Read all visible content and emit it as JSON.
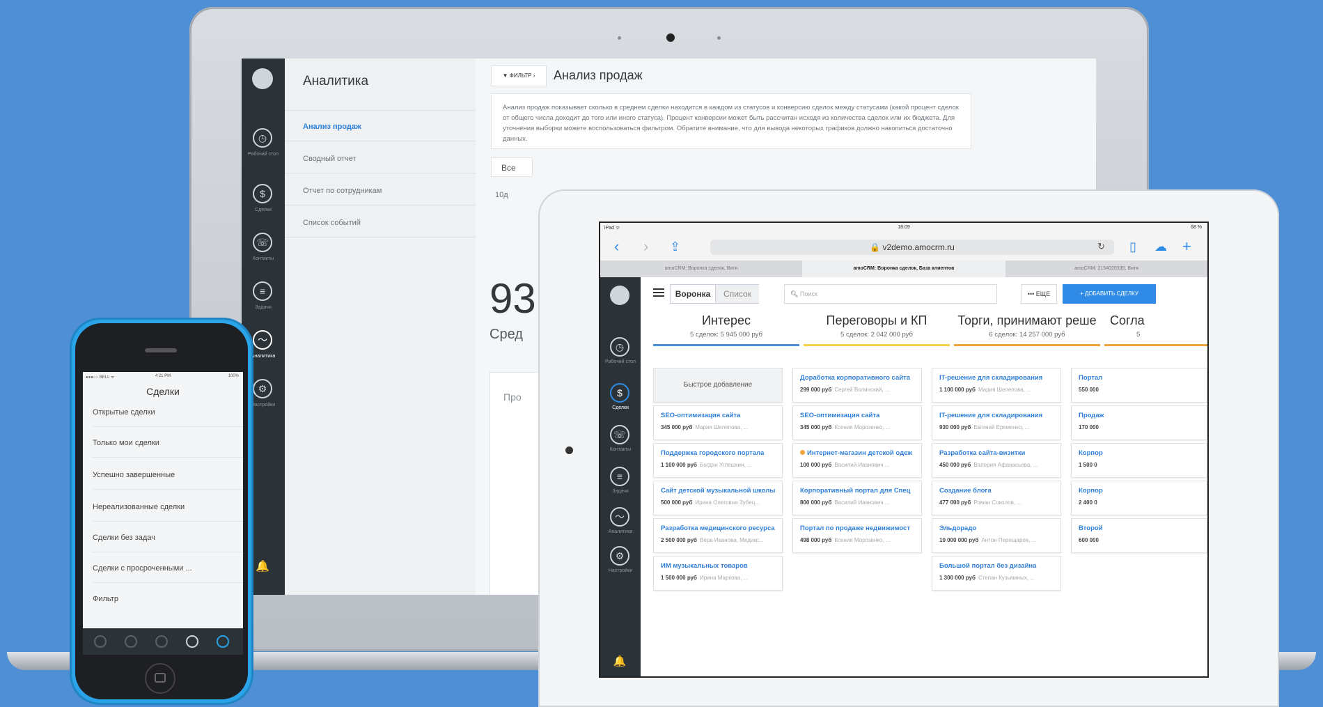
{
  "colors": {
    "background": "#4f8fd6",
    "accent": "#2f8be6",
    "sidebar": "#2c3338"
  },
  "laptop": {
    "nav_title": "Аналитика",
    "nav_items": [
      "Анализ продаж",
      "Сводный отчет",
      "Отчет по сотрудникам",
      "Список событий"
    ],
    "rail_labels": [
      "Рабочий стол",
      "Сделки",
      "Контакты",
      "Задачи",
      "Аналитика",
      "Настройки"
    ],
    "filter_label": "ФИЛЬТР",
    "main_title": "Анализ продаж",
    "description": "Анализ продаж показывает сколько в среднем сделки находится в каждом из статусов и конверсию сделок между статусами (какой процент сделок от общего числа доходит до того или иного статуса). Процент конверсии может быть рассчитан исходя из количества сделок или их бюджета. Для уточнения выборки можете воспользоваться фильтром. Обратите внимание, что для вывода некоторых графиков должно накопиться достаточно данных.",
    "all_label": "Все",
    "period_label": "10д",
    "big_number": "93",
    "subtitle": "Сред",
    "pro_label": "Про"
  },
  "phone": {
    "status_left": "●●●○○ BELL ᯤ",
    "status_time": "4:21 PM",
    "status_right": "100%",
    "title": "Сделки",
    "items": [
      "Открытые сделки",
      "Только мои сделки",
      "Успешно завершенные",
      "Нереализованные сделки",
      "Сделки без задач",
      "Сделки с просроченными ...",
      "Фильтр"
    ]
  },
  "ipad": {
    "status_left": "iPad ᯤ",
    "status_time": "18:09",
    "status_right": "68 %",
    "url": "v2demo.amocrm.ru",
    "tabs": [
      "amoCRM: Воронка сделок, Витя",
      "amoCRM: Воронка сделок, База клиентов",
      "amoCRM: 2154020335, Витя"
    ],
    "view_funnel": "Воронка",
    "view_list": "Список",
    "search_placeholder": "Поиск",
    "more_label": "••• ЕЩЕ",
    "add_label": "+ ДОБАВИТЬ СДЕЛКУ",
    "rail_labels": [
      "Рабочий стол",
      "Сделки",
      "Контакты",
      "Задачи",
      "Аналитика",
      "Настройки"
    ],
    "quick_add": "Быстрое добавление",
    "columns": [
      {
        "title": "Интерес",
        "summary": "5 сделок: 5 945 000 руб",
        "color": "#4a90d9",
        "cards": [
          {
            "title": "SEO-оптимизация сайта",
            "price": "345 000 руб",
            "contact": "Мария Шелепова, ..."
          },
          {
            "title": "Поддержка городского портала",
            "price": "1 100 000 руб",
            "contact": "Богдан Углешкин, ..."
          },
          {
            "title": "Сайт детской музыкальной школы",
            "price": "500 000 руб",
            "contact": "Ирина Олеговна Зубец..."
          },
          {
            "title": "Разработка медицинского ресурса",
            "price": "2 500 000 руб",
            "contact": "Вера Иванова, Медикс..."
          },
          {
            "title": "ИМ музыкальных товаров",
            "price": "1 500 000 руб",
            "contact": "Ирина Маркова, ..."
          }
        ]
      },
      {
        "title": "Переговоры и КП",
        "summary": "5 сделок: 2 042 000 руб",
        "color": "#f3d348",
        "cards": [
          {
            "title": "Доработка корпоративного сайта",
            "price": "299 000 руб",
            "contact": "Сергей Волинский, ..."
          },
          {
            "title": "SEO-оптимизация сайта",
            "price": "345 000 руб",
            "contact": "Ксения Морозенко, ..."
          },
          {
            "title": "Интернет-магазин детской одеж",
            "price": "100 000 руб",
            "contact": "Василий Иванович ..."
          },
          {
            "title": "Корпоративный портал для Спец",
            "price": "800 000 руб",
            "contact": "Василий Иванович ..."
          },
          {
            "title": "Портал по продаже недвижимост",
            "price": "498 000 руб",
            "contact": "Ксения Морозенко, ..."
          }
        ]
      },
      {
        "title": "Торги, принимают реше",
        "summary": "6 сделок: 14 257 000 руб",
        "color": "#f0a23c",
        "cards": [
          {
            "title": "IT-решение для складирования",
            "price": "1 100 000 руб",
            "contact": "Мария Шелепова, ..."
          },
          {
            "title": "IT-решение для складирования",
            "price": "930 000 руб",
            "contact": "Евгений Еременко, ..."
          },
          {
            "title": "Разработка сайта-визитки",
            "price": "450 000 руб",
            "contact": "Валерия Афанасьева, ..."
          },
          {
            "title": "Создание блога",
            "price": "477 000 руб",
            "contact": "Роман Соколов, ..."
          },
          {
            "title": "Эльдорадо",
            "price": "10 000 000 руб",
            "contact": "Антон Перещаров, ..."
          },
          {
            "title": "Большой портал без дизайна",
            "price": "1 300 000 руб",
            "contact": "Степан Кузьминых, ..."
          }
        ]
      },
      {
        "title": "Согла",
        "summary": "5",
        "color": "#f0a23c",
        "cards": [
          {
            "title": "Портал",
            "price": "550 000",
            "contact": ""
          },
          {
            "title": "Продаж",
            "price": "170 000",
            "contact": ""
          },
          {
            "title": "Корпор",
            "price": "1 500 0",
            "contact": ""
          },
          {
            "title": "Корпор",
            "price": "2 400 0",
            "contact": ""
          },
          {
            "title": "Второй",
            "price": "600 000",
            "contact": ""
          }
        ]
      }
    ]
  }
}
